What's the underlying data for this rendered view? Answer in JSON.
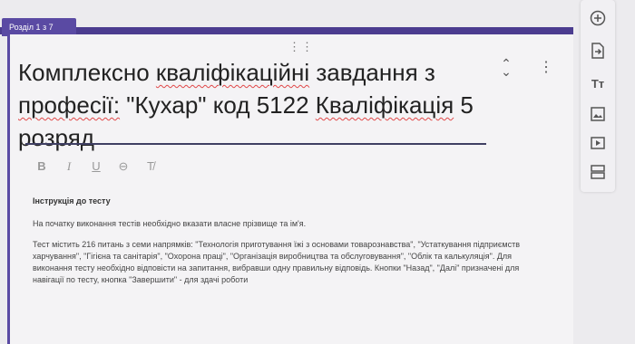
{
  "section_tab": "Розділ 1 з 7",
  "title": {
    "parts": [
      {
        "text": "Комплексно ",
        "sp": false
      },
      {
        "text": "кваліфікаційні",
        "sp": true
      },
      {
        "text": " завдання з ",
        "sp": false
      },
      {
        "text": "професії:",
        "sp": true
      },
      {
        "text": " \"Кухар\"  код 5122 ",
        "sp": false
      },
      {
        "text": "Кваліфікація",
        "sp": true
      },
      {
        "text": "  5 розряд",
        "sp": false
      }
    ]
  },
  "format_toolbar": {
    "bold": "B",
    "italic": "I",
    "underline": "U",
    "link": "⊖",
    "clear": "T̸"
  },
  "description": {
    "header": "Інструкція до тесту",
    "p1": "На початку виконання  тестів необхідно вказати власне прізвище та ім'я.",
    "p2": "Тест містить 216 питань з семи напрямків: \"Технологія приготування їжі з основами товарознавства\", \"Устаткування підприємств харчування\", \"Гігієна та санітарія\", \"Охорона праці\", \"Організація виробництва та обслуговування\", \"Облік та калькуляція\". Для виконання тесту необхідно відповісти на запитання, вибравши одну правильну відповідь. Кнопки \"Назад\", \"Далі\" призначені для навігації по тесту, кнопка \"Завершити\" - для здачі роботи"
  },
  "colors": {
    "accent": "#5a4aa3",
    "accent_dark": "#4b3c8f",
    "spell": "#e04848"
  },
  "side_icons": [
    "add-question-icon",
    "import-questions-icon",
    "add-title-icon",
    "add-image-icon",
    "add-video-icon",
    "add-section-icon"
  ]
}
